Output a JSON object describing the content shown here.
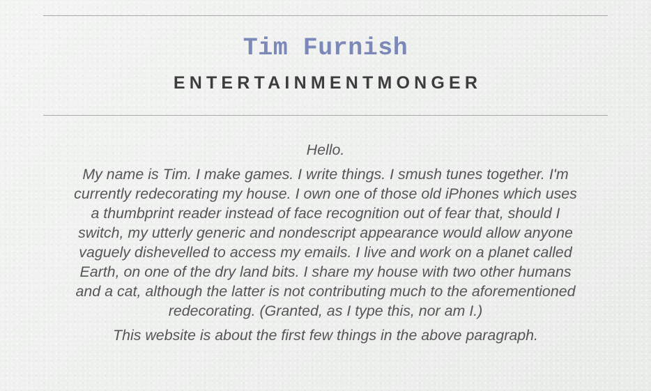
{
  "header": {
    "name": "Tim Furnish",
    "tagline": "ENTERTAINMENTMONGER"
  },
  "content": {
    "greeting": "Hello.",
    "bio": "My name is Tim. I make games. I write things. I smush tunes together. I'm currently redecorating my house. I own one of those old iPhones which uses a thumbprint reader instead of face recognition out of fear that, should I switch, my utterly generic and nondescript appearance would allow anyone vaguely dishevelled to access my emails. I live and work on a planet called Earth, on one of the dry land bits. I share my house with two other humans and a cat, although the latter is not contributing much to the aforementioned redecorating. (Granted, as I type this, nor am I.)",
    "about": "This website is about the first few things in the above paragraph."
  },
  "colors": {
    "name": "#7b88b8",
    "tagline": "#3d3d3d",
    "body_text": "#555555",
    "background": "#eef0ee",
    "rule": "#a9a9a9"
  }
}
